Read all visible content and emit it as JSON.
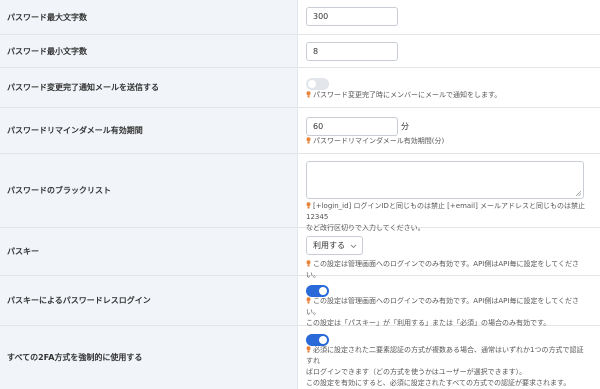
{
  "colors": {
    "label_bg": "#f1f4f9",
    "accent": "#2a6ad8",
    "hint_icon": "#e8833a"
  },
  "rows": {
    "max_length": {
      "label": "パスワード最大文字数",
      "value": "300"
    },
    "min_length": {
      "label": "パスワード最小文字数",
      "value": "8"
    },
    "change_mail": {
      "label": "パスワード変更完了通知メールを送信する",
      "toggle": "off",
      "help": "パスワード変更完了時にメンバーにメールで通知をします。"
    },
    "reminder": {
      "label": "パスワードリマインダメール有効期間",
      "value": "60",
      "unit": "分",
      "help": "パスワードリマインダメール有効期間(分)"
    },
    "blacklist": {
      "label": "パスワードのブラックリスト",
      "value": "",
      "help1": "[+login_id] ログインIDと同じものは禁止 [+email] メールアドレスと同じものは禁止 12345",
      "help2": "など改行区切りで入力してください。"
    },
    "passkey": {
      "label": "パスキー",
      "selected": "利用する",
      "help": "この設定は管理画面へのログインでのみ有効です。API側はAPI毎に設定をしてください。"
    },
    "passwordless": {
      "label": "パスキーによるパスワードレスログイン",
      "toggle": "on",
      "help1": "この設定は管理画面へのログインでのみ有効です。API側はAPI毎に設定をしてください。",
      "help2": "この設定は「パスキー」が「利用する」または「必須」の場合のみ有効です。"
    },
    "force_2fa": {
      "label": "すべての2FA方式を強制的に使用する",
      "toggle": "on",
      "help1": "必須に設定された二要素認証の方式が複数ある場合、通常はいずれか1つの方式で認証すれ",
      "help2": "ばログインできます（どの方式を使うかはユーザーが選択できます）。",
      "help3": "この設定を有効にすると、必須に設定されたすべての方式での認証が要求されます。"
    }
  }
}
